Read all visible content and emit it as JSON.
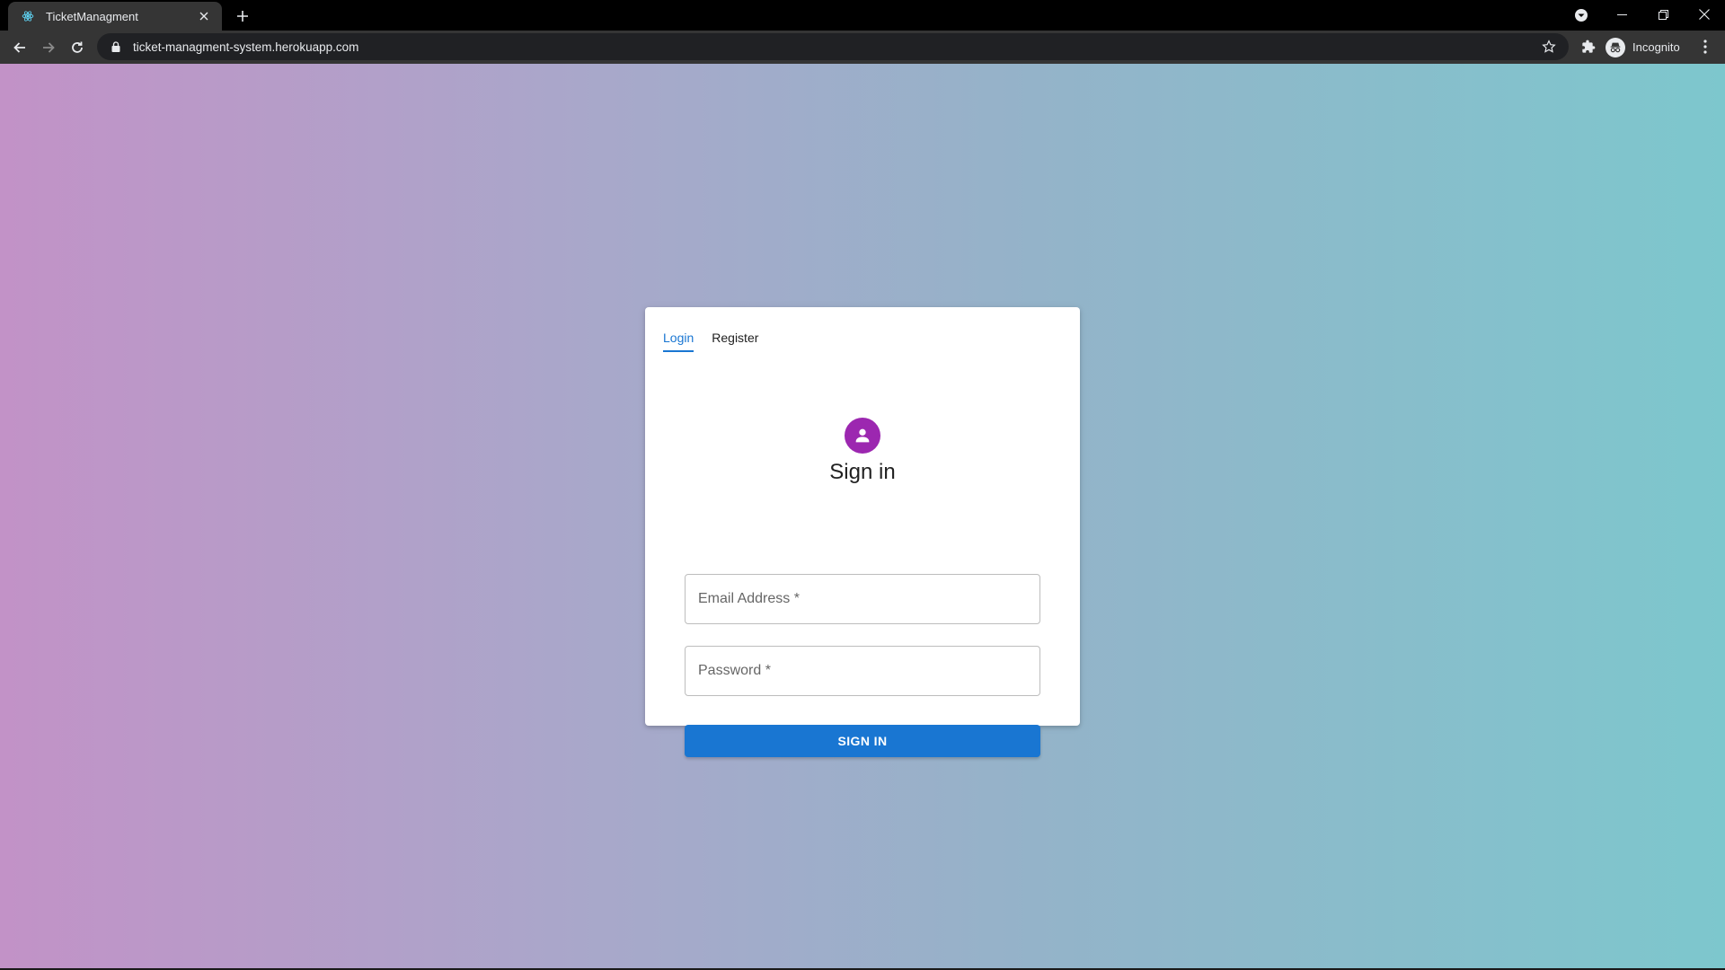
{
  "browser": {
    "tab_title": "TicketManagment",
    "url": "ticket-managment-system.herokuapp.com",
    "profile_label": "Incognito"
  },
  "page": {
    "tabs": [
      {
        "label": "Login",
        "active": true
      },
      {
        "label": "Register",
        "active": false
      }
    ],
    "heading": "Sign in",
    "email_placeholder": "Email Address *",
    "password_placeholder": "Password *",
    "submit_label": "SIGN IN"
  },
  "colors": {
    "primary": "#1976d2",
    "avatar": "#9c27b0",
    "gradient_left": "#c292c7",
    "gradient_right": "#7dc7cd"
  }
}
